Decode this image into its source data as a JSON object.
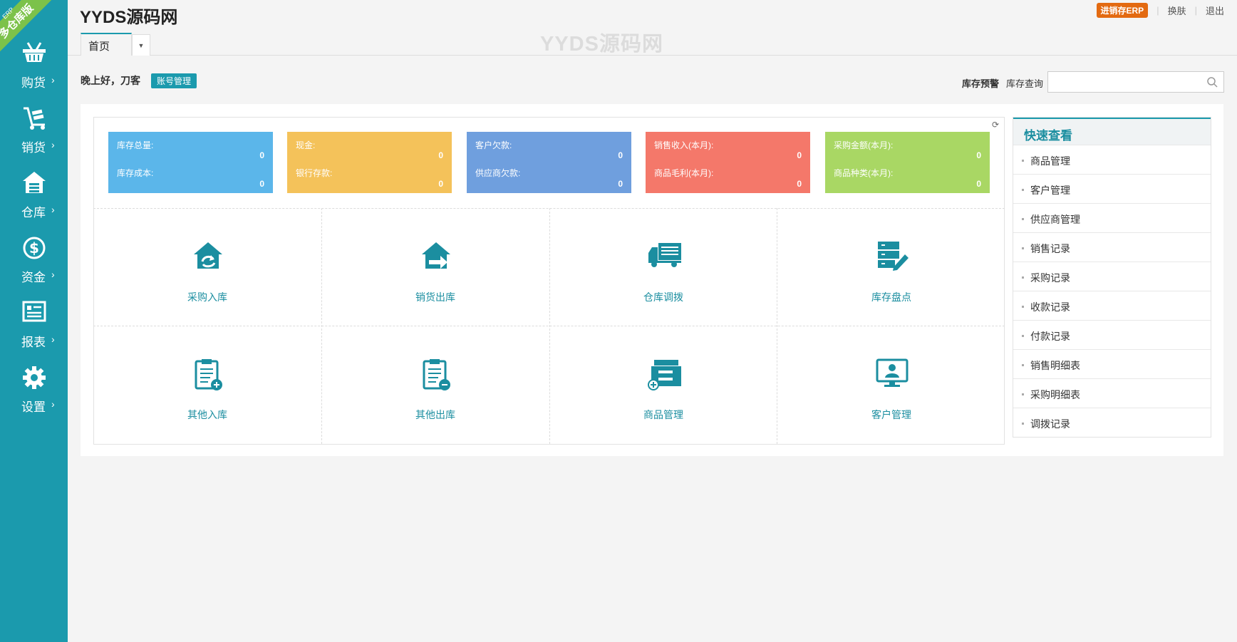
{
  "app": {
    "title": "YYDS源码网",
    "watermark": "YYDS源码网",
    "ribbon_main": "多仓库版",
    "ribbon_small": "ERP"
  },
  "colors": {
    "primary": "#1b9aad",
    "accent": "#e36a11",
    "stat_blue": "#5bb6ea",
    "stat_yellow": "#f4c25a",
    "stat_purple": "#6f9fde",
    "stat_red": "#f4786a",
    "stat_green": "#a9d764"
  },
  "sidebar": {
    "items": [
      {
        "label": "购货",
        "arrow": "›",
        "icon": "basket-icon"
      },
      {
        "label": "销货",
        "arrow": "›",
        "icon": "hand-truck-icon"
      },
      {
        "label": "仓库",
        "arrow": "›",
        "icon": "warehouse-icon"
      },
      {
        "label": "资金",
        "arrow": "›",
        "icon": "dollar-icon"
      },
      {
        "label": "报表",
        "arrow": "›",
        "icon": "report-icon"
      },
      {
        "label": "设置",
        "arrow": "›",
        "icon": "gear-icon"
      }
    ]
  },
  "header": {
    "erp_badge": "进销存ERP",
    "skin": "换肤",
    "logout": "退出",
    "separator": "|",
    "tab": "首页",
    "tab_dropdown": "▼"
  },
  "greeting": {
    "text": "晚上好，刀客",
    "account_button": "账号管理"
  },
  "stock": {
    "warn": "库存预警",
    "query": "库存查询",
    "search_placeholder": ""
  },
  "stats": [
    {
      "label1": "库存总量:",
      "value1": "0",
      "label2": "库存成本:",
      "value2": "0"
    },
    {
      "label1": "现金:",
      "value1": "0",
      "label2": "银行存款:",
      "value2": "0"
    },
    {
      "label1": "客户欠款:",
      "value1": "0",
      "label2": "供应商欠款:",
      "value2": "0"
    },
    {
      "label1": "销售收入(本月):",
      "value1": "0",
      "label2": "商品毛利(本月):",
      "value2": "0"
    },
    {
      "label1": "采购金额(本月):",
      "value1": "0",
      "label2": "商品种类(本月):",
      "value2": "0"
    }
  ],
  "tiles": [
    {
      "label": "采购入库",
      "icon": "purchase-in-icon"
    },
    {
      "label": "销货出库",
      "icon": "sales-out-icon"
    },
    {
      "label": "仓库调拨",
      "icon": "truck-icon"
    },
    {
      "label": "库存盘点",
      "icon": "inventory-check-icon"
    },
    {
      "label": "其他入库",
      "icon": "clipboard-in-icon"
    },
    {
      "label": "其他出库",
      "icon": "clipboard-out-icon"
    },
    {
      "label": "商品管理",
      "icon": "product-box-icon"
    },
    {
      "label": "客户管理",
      "icon": "customer-monitor-icon"
    }
  ],
  "quick": {
    "title": "快速查看",
    "items": [
      "商品管理",
      "客户管理",
      "供应商管理",
      "销售记录",
      "采购记录",
      "收款记录",
      "付款记录",
      "销售明细表",
      "采购明细表",
      "调拨记录"
    ]
  }
}
